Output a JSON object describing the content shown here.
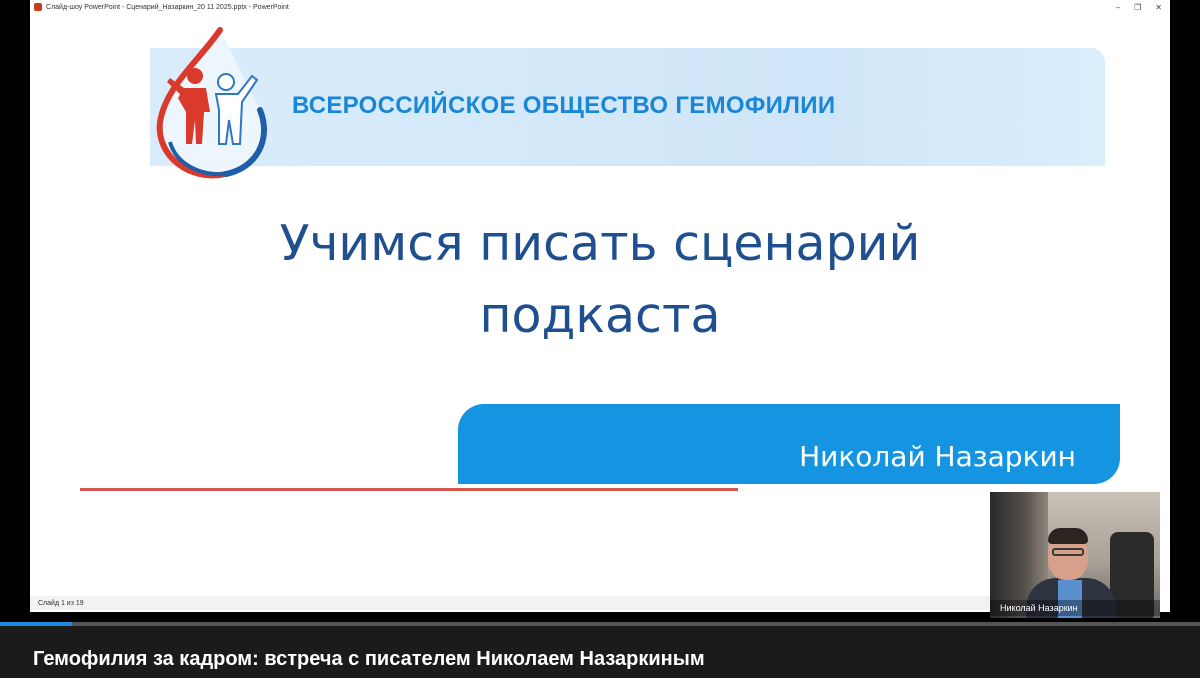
{
  "window": {
    "title": "Слайд-шоу PowerPoint  -  Сценарий_Назаркин_20 11 2025.pptx - PowerPoint",
    "controls": [
      "–",
      "❐",
      "✕"
    ]
  },
  "slide": {
    "organization": "ВСЕРОССИЙСКОЕ ОБЩЕСТВО ГЕМОФИЛИИ",
    "title_line1": "Учимся писать сценарий",
    "title_line2": "подкаста",
    "author": "Николай Назаркин"
  },
  "statusbar": {
    "slide_counter": "Слайд 1 из 19"
  },
  "webcam": {
    "participant_name": "Николай Назаркин"
  },
  "video": {
    "progress_fraction": 0.06,
    "caption": "Гемофилия за кадром: встреча с писателем Николаем Назаркиным"
  },
  "colors": {
    "org_blue": "#1a86d6",
    "title_blue": "#1f4f8f",
    "author_banner": "#1594e2",
    "accent_red": "#d9534f"
  }
}
